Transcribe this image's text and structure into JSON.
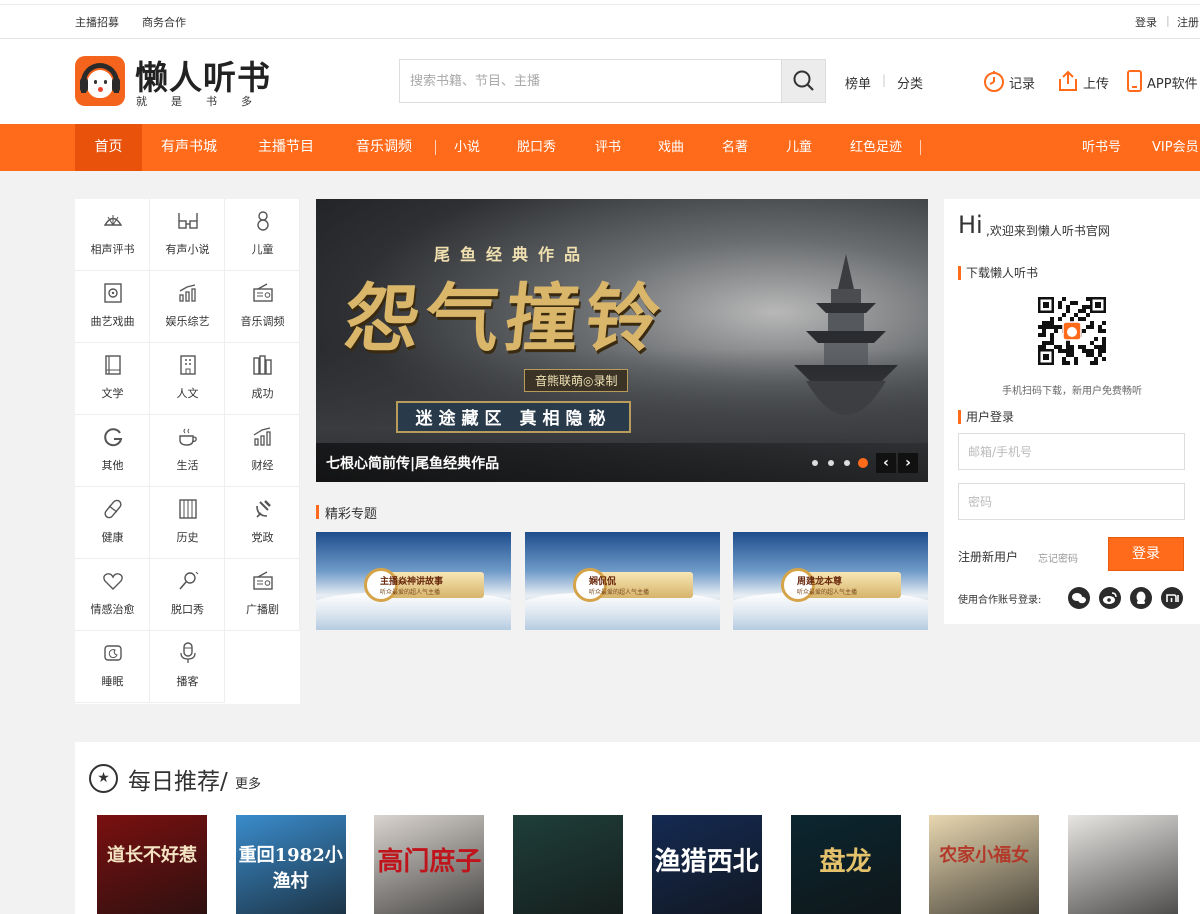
{
  "topbar": {
    "links_left": [
      "主播招募",
      "商务合作"
    ],
    "login": "登录",
    "register": "注册"
  },
  "header": {
    "logo_title": "懒人听书",
    "logo_sub": "就是书多",
    "search_placeholder": "搜索书籍、节目、主播",
    "links": [
      "榜单",
      "分类"
    ],
    "actions": [
      "记录",
      "上传",
      "APP软件"
    ]
  },
  "nav": {
    "items": [
      "首页",
      "有声书城",
      "主播节目",
      "音乐调频",
      "小说",
      "脱口秀",
      "评书",
      "戏曲",
      "名著",
      "儿童",
      "红色足迹"
    ],
    "right": [
      "听书号",
      "VIP会员"
    ],
    "active": "首页"
  },
  "categories": [
    {
      "label": "相声评书",
      "icon": "fan-icon"
    },
    {
      "label": "有声小说",
      "icon": "glasses-icon"
    },
    {
      "label": "儿童",
      "icon": "child-icon"
    },
    {
      "label": "曲艺戏曲",
      "icon": "speaker-icon"
    },
    {
      "label": "娱乐综艺",
      "icon": "bars-icon"
    },
    {
      "label": "音乐调频",
      "icon": "radio-icon"
    },
    {
      "label": "文学",
      "icon": "book-icon"
    },
    {
      "label": "人文",
      "icon": "building-icon"
    },
    {
      "label": "成功",
      "icon": "books-icon"
    },
    {
      "label": "其他",
      "icon": "g-icon"
    },
    {
      "label": "生活",
      "icon": "cup-icon"
    },
    {
      "label": "财经",
      "icon": "chart-icon"
    },
    {
      "label": "健康",
      "icon": "pill-icon"
    },
    {
      "label": "历史",
      "icon": "scroll-icon"
    },
    {
      "label": "党政",
      "icon": "hammer-sickle-icon"
    },
    {
      "label": "情感治愈",
      "icon": "heart-icon"
    },
    {
      "label": "脱口秀",
      "icon": "microphone-icon"
    },
    {
      "label": "广播剧",
      "icon": "radio-icon"
    },
    {
      "label": "睡眠",
      "icon": "moon-icon"
    },
    {
      "label": "播客",
      "icon": "mic-stand-icon"
    }
  ],
  "banner": {
    "subtitle": "尾鱼经典作品",
    "title": "怨气撞铃",
    "recorded": "音熊联萌◎录制",
    "tagline": "迷途藏区 真相隐秘",
    "caption": "七根心简前传|尾鱼经典作品",
    "slide_count": 4,
    "active_slide": 4
  },
  "topics": {
    "title": "精彩专题",
    "items": [
      {
        "name": "主播焱神讲故事",
        "desc": "听众最爱的超人气主播"
      },
      {
        "name": "娴侃侃",
        "desc": "听众最爱的超人气主播"
      },
      {
        "name": "周建龙本尊",
        "desc": "听众最爱的超人气主播"
      }
    ]
  },
  "right_panel": {
    "hi": "Hi",
    "welcome": ",欢迎来到懒人听书官网",
    "download_title": "下载懒人听书",
    "qr_tip": "手机扫码下载，新用户免费畅听",
    "login_title": "用户登录",
    "email_placeholder": "邮箱/手机号",
    "password_placeholder": "密码",
    "register": "注册新用户",
    "forgot": "忘记密码",
    "login_button": "登录",
    "partner_login": "使用合作账号登录:",
    "partners": [
      "wechat-icon",
      "weibo-icon",
      "qq-icon",
      "xiaomi-icon"
    ]
  },
  "daily": {
    "title": "每日推荐",
    "slash": "/",
    "more": "更多",
    "books": [
      {
        "title": "道长不好惹",
        "bg": "#7a1010",
        "fg": "#f4e3c3"
      },
      {
        "title": "重回1982小渔村",
        "bg": "#3a8ccc",
        "fg": "#ffffff"
      },
      {
        "title": "高门庶子",
        "bg": "#d9d4cf",
        "fg": "#c0141c"
      },
      {
        "title": "",
        "bg": "#1f3f3a",
        "fg": "#ffffff"
      },
      {
        "title": "渔猎西北",
        "bg": "#142a52",
        "fg": "#ffffff"
      },
      {
        "title": "盘龙",
        "bg": "#0b2630",
        "fg": "#e4c16b"
      },
      {
        "title": "农家小福女",
        "bg": "#e8d7b0",
        "fg": "#b33a2a"
      },
      {
        "title": "",
        "bg": "#e8e6e3",
        "fg": "#333333"
      }
    ]
  }
}
